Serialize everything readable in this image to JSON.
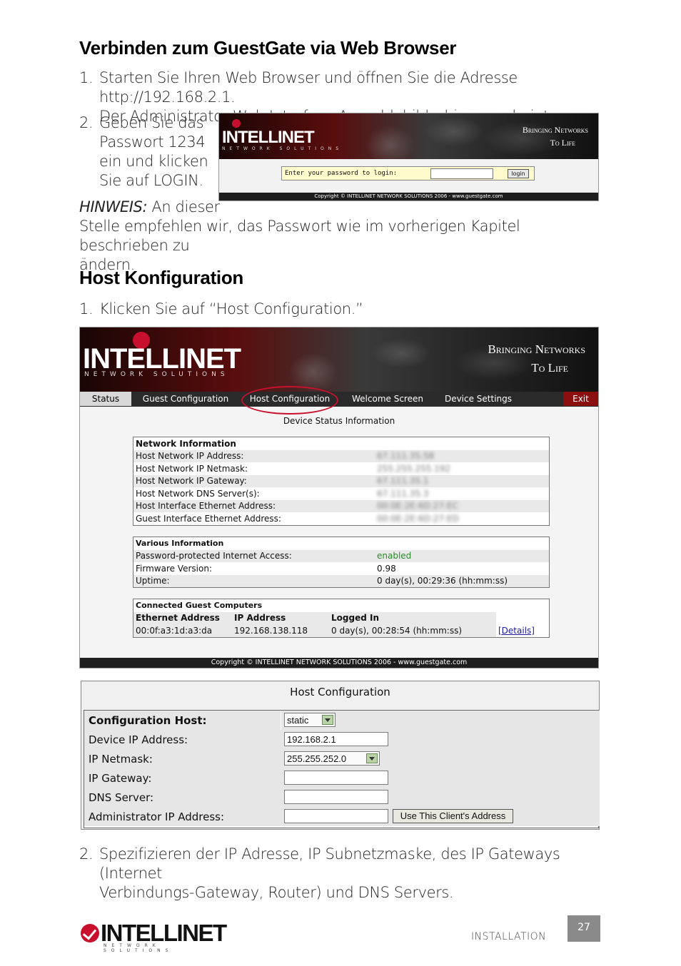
{
  "section1": {
    "heading": "Verbinden zum GuestGate via Web Browser",
    "step1_num": "1.",
    "step1_line1": "Starten Sie Ihren Web Browser und öffnen Sie die Adresse http://192.168.2.1.",
    "step1_line2": "Der Administrator Web Interface Anmeldebildschirm erscheint nun.",
    "step2_num": "2.",
    "step2_lines": [
      "Geben Sie das",
      "Passwort 1234",
      "ein und klicken",
      "Sie auf LOGIN."
    ],
    "hinweis_label": "HINWEIS:",
    "hinweis_line1": "An dieser",
    "hinweis_line2": "Stelle empfehlen wir, das Passwort wie im vorherigen Kapitel beschrieben zu",
    "hinweis_line3": "ändern."
  },
  "login_screen": {
    "brand": "INTELLINET",
    "brand_sub": "NETWORK SOLUTIONS",
    "tagline_line1": "Bringing Networks",
    "tagline_line2": "To Life",
    "password_prompt": "Enter your password to login:",
    "password_value": "",
    "login_button": "login",
    "copyright": "Copyright © INTELLINET NETWORK SOLUTIONS 2006 - www.guestgate.com"
  },
  "section2": {
    "heading": "Host Konfiguration",
    "step1_num": "1.",
    "step1": "Klicken Sie auf  “Host Configuration.”",
    "step2_num": "2.",
    "step2_line1": "Spezifizieren der IP Adresse, IP Subnetzmaske, des IP Gateways (Internet",
    "step2_line2": "Verbindungs-Gateway, Router) und DNS Servers."
  },
  "status_screen": {
    "brand": "INTELLINET",
    "brand_sub": "NETWORK SOLUTIONS",
    "tagline_line1": "Bringing Networks",
    "tagline_line2": "To Life",
    "tabs": [
      "Status",
      "Guest Configuration",
      "Host Configuration",
      "Welcome Screen",
      "Device Settings",
      "Exit"
    ],
    "page_title": "Device Status Information",
    "network_info": {
      "title": "Network Information",
      "rows": [
        {
          "label": "Host Network IP Address:",
          "value": "67.111.35.58"
        },
        {
          "label": "Host Network IP Netmask:",
          "value": "255.255.255.192"
        },
        {
          "label": "Host Network IP Gateway:",
          "value": "67.111.35.1"
        },
        {
          "label": "Host Network DNS Server(s):",
          "value": "67.111.35.3"
        },
        {
          "label": "Host Interface Ethernet Address:",
          "value": "00:0E:2E:6D:27:EC"
        },
        {
          "label": "Guest Interface Ethernet Address:",
          "value": "00:0E:2E:6D:27:ED"
        }
      ]
    },
    "various_info": {
      "title": "Various Information",
      "rows": [
        {
          "label": "Password-protected Internet Access:",
          "value": "enabled"
        },
        {
          "label": "Firmware Version:",
          "value": "0.98"
        },
        {
          "label": "Uptime:",
          "value": "0 day(s), 00:29:36 (hh:mm:ss)"
        }
      ]
    },
    "guests": {
      "title": "Connected Guest Computers",
      "headers": [
        "Ethernet Address",
        "IP Address",
        "Logged In"
      ],
      "row": {
        "eth": "00:0f:a3:1d:a3:da",
        "ip": "192.168.138.118",
        "logged": "0 day(s), 00:28:54 (hh:mm:ss)",
        "link": "[Details]"
      }
    },
    "copyright": "Copyright © INTELLINET NETWORK SOLUTIONS 2006 - www.guestgate.com"
  },
  "host_config": {
    "title": "Host Configuration",
    "rows": [
      {
        "label": "Configuration Host:",
        "value": "static"
      },
      {
        "label": "Device IP Address:",
        "value": "192.168.2.1"
      },
      {
        "label": "IP Netmask:",
        "value": "255.255.252.0"
      },
      {
        "label": "IP Gateway:",
        "value": ""
      },
      {
        "label": "DNS Server:",
        "value": ""
      },
      {
        "label": "Administrator IP Address:",
        "value": ""
      }
    ],
    "use_client_button": "Use This Client's Address"
  },
  "footer": {
    "brand": "INTELLINET",
    "brand_sub": "NETWORK SOLUTIONS",
    "section": "INSTALLATION",
    "page_number": "27"
  },
  "colors": {
    "brand_red": "#8b0f0f",
    "tab_active": "#d8d8d8",
    "accent_red": "#c8102e",
    "enabled_green": "#2a8a2a"
  }
}
